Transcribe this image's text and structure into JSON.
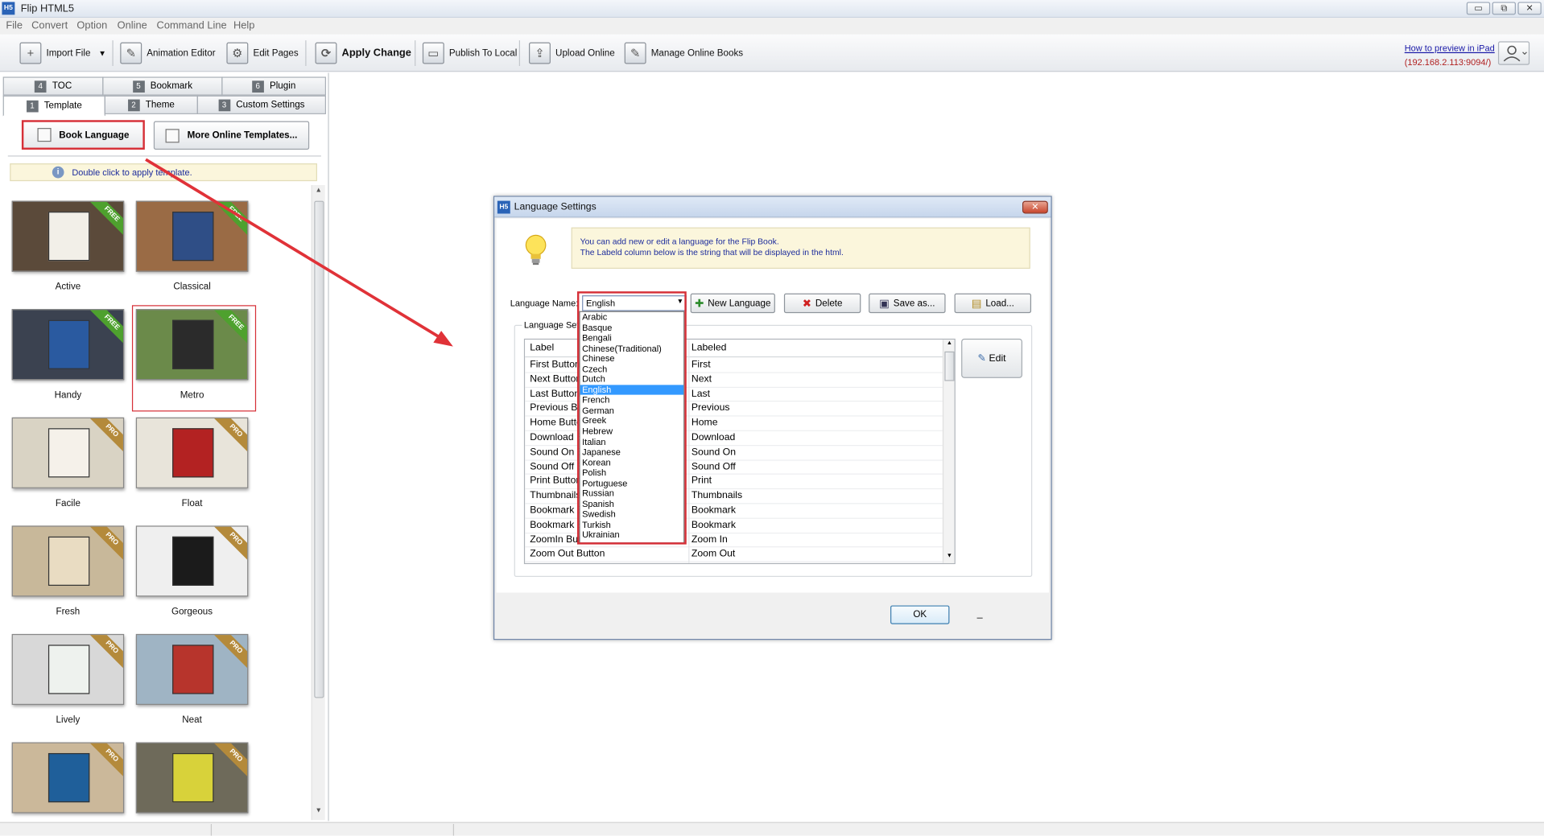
{
  "window": {
    "title": "Flip HTML5",
    "min": "▭",
    "max": "⧉",
    "close": "✕"
  },
  "menu": [
    "File",
    "Convert",
    "Option",
    "Online",
    "Command Line",
    "Help"
  ],
  "toolbar": {
    "import_file": "Import File",
    "animation_editor": "Animation Editor",
    "edit_pages": "Edit Pages",
    "apply_change": "Apply Change",
    "publish_local": "Publish To Local",
    "upload_online": "Upload Online",
    "manage_online": "Manage Online Books",
    "preview_link": "How to preview in iPad",
    "preview_ip": "(192.168.2.113:9094/)"
  },
  "tabs_row1": [
    {
      "num": "4",
      "label": "TOC"
    },
    {
      "num": "5",
      "label": "Bookmark"
    },
    {
      "num": "6",
      "label": "Plugin"
    }
  ],
  "tabs_row2": [
    {
      "num": "1",
      "label": "Template"
    },
    {
      "num": "2",
      "label": "Theme"
    },
    {
      "num": "3",
      "label": "Custom Settings"
    }
  ],
  "left": {
    "book_language": "Book Language",
    "more_templates": "More Online Templates...",
    "hint": "Double click to apply template."
  },
  "templates": [
    {
      "name": "Active",
      "badge": "FREE",
      "bg": "#5b4a3a",
      "book": "#f2efe8"
    },
    {
      "name": "Classical",
      "badge": "FREE",
      "bg": "#9a6b45",
      "book": "#2f4e86"
    },
    {
      "name": "Handy",
      "badge": "FREE",
      "bg": "#3b4250",
      "book": "#2a5aa0"
    },
    {
      "name": "Metro",
      "badge": "FREE",
      "bg": "#6b8a4a",
      "book": "#2b2b2b"
    },
    {
      "name": "Facile",
      "badge": "PRO",
      "bg": "#d9d3c4",
      "book": "#f5f1ea"
    },
    {
      "name": "Float",
      "badge": "PRO",
      "bg": "#e8e4da",
      "book": "#b32222"
    },
    {
      "name": "Fresh",
      "badge": "PRO",
      "bg": "#c8b89a",
      "book": "#e9dcc2"
    },
    {
      "name": "Gorgeous",
      "badge": "PRO",
      "bg": "#efefef",
      "book": "#1b1b1b"
    },
    {
      "name": "Lively",
      "badge": "PRO",
      "bg": "#d8d8d8",
      "book": "#eef2ee"
    },
    {
      "name": "Neat",
      "badge": "PRO",
      "bg": "#9fb4c4",
      "book": "#b7342c"
    },
    {
      "name": "",
      "badge": "PRO",
      "bg": "#cbb89a",
      "book": "#1f5f9a"
    },
    {
      "name": "",
      "badge": "PRO",
      "bg": "#6e6a5a",
      "book": "#d8d23a"
    }
  ],
  "dialog": {
    "title": "Language Settings",
    "close": "✕",
    "notice_line1": "You can add new or edit  a language for the Flip Book.",
    "notice_line2": "The Labeld column below is the string that will be displayed in the html.",
    "language_name_label": "Language Name:",
    "language_value": "English",
    "new_language": "New Language",
    "delete": "Delete",
    "save_as": "Save as...",
    "load": "Load...",
    "group_title": "Language Setti",
    "col_label": "Label",
    "col_labeled": "Labeled",
    "edit": "Edit",
    "ok": "OK",
    "dash": "_",
    "rows": [
      {
        "label": "First Button",
        "labeled": "First"
      },
      {
        "label": "Next Button",
        "labeled": "Next"
      },
      {
        "label": "Last Button",
        "labeled": "Last"
      },
      {
        "label": "Previous Button",
        "labeled": "Previous"
      },
      {
        "label": "Home Button",
        "labeled": "Home"
      },
      {
        "label": "Download Button",
        "labeled": "Download"
      },
      {
        "label": "Sound On Button",
        "labeled": "Sound On"
      },
      {
        "label": "Sound Off Button",
        "labeled": "Sound Off"
      },
      {
        "label": "Print Button",
        "labeled": "Print"
      },
      {
        "label": "Thumbnails Button",
        "labeled": "Thumbnails"
      },
      {
        "label": "Bookmark Button",
        "labeled": "Bookmark"
      },
      {
        "label": "Bookmark Button",
        "labeled": "Bookmark"
      },
      {
        "label": "ZoomIn Button",
        "labeled": "Zoom In"
      },
      {
        "label": "Zoom Out Button",
        "labeled": "Zoom Out"
      }
    ]
  },
  "languages": [
    "Arabic",
    "Basque",
    "Bengali",
    "Chinese(Traditional)",
    "Chinese",
    "Czech",
    "Dutch",
    "English",
    "French",
    "German",
    "Greek",
    "Hebrew",
    "Italian",
    "Japanese",
    "Korean",
    "Polish",
    "Portuguese",
    "Russian",
    "Spanish",
    "Swedish",
    "Turkish",
    "Ukrainian"
  ],
  "selected_language": "English",
  "colors": {
    "highlight_red": "#d63038",
    "selection_blue": "#3399ff",
    "arrow_red": "#e03238"
  }
}
